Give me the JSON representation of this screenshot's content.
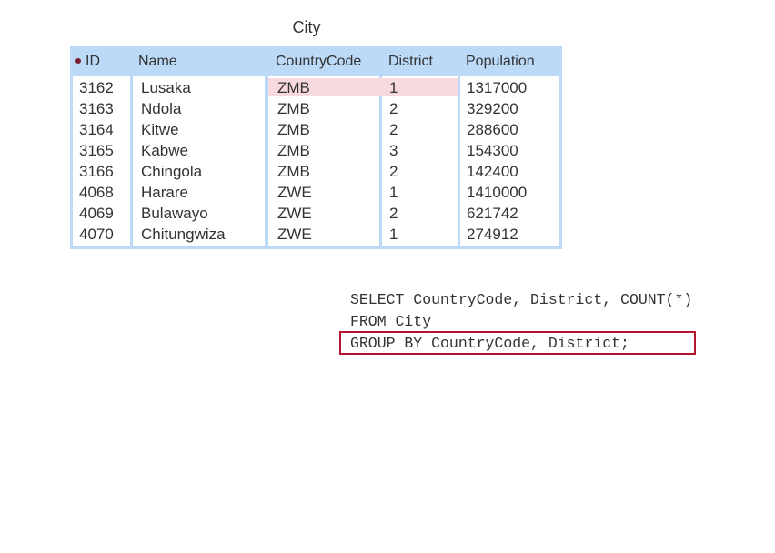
{
  "table": {
    "title": "City",
    "columns": [
      "ID",
      "Name",
      "CountryCode",
      "District",
      "Population"
    ],
    "rows": [
      [
        "3162",
        "Lusaka",
        "ZMB",
        "1",
        "1317000"
      ],
      [
        "3163",
        "Ndola",
        "ZMB",
        "2",
        "329200"
      ],
      [
        "3164",
        "Kitwe",
        "ZMB",
        "2",
        "288600"
      ],
      [
        "3165",
        "Kabwe",
        "ZMB",
        "3",
        "154300"
      ],
      [
        "3166",
        "Chingola",
        "ZMB",
        "2",
        "142400"
      ],
      [
        "4068",
        "Harare",
        "ZWE",
        "1",
        "1410000"
      ],
      [
        "4069",
        "Bulawayo",
        "ZWE",
        "2",
        "621742"
      ],
      [
        "4070",
        "Chitungwiza",
        "ZWE",
        "1",
        "274912"
      ]
    ],
    "highlighted_row": 0
  },
  "query": {
    "lines": [
      "SELECT CountryCode, District, COUNT(*)",
      "FROM City",
      "GROUP BY CountryCode, District;"
    ],
    "highlighted_line": 2
  },
  "colors": {
    "table_header": "#bcd9f7",
    "row_highlight": "#f7d9de",
    "box_outline": "#b3132e",
    "primary_key_dot": "#7a1f2b"
  }
}
